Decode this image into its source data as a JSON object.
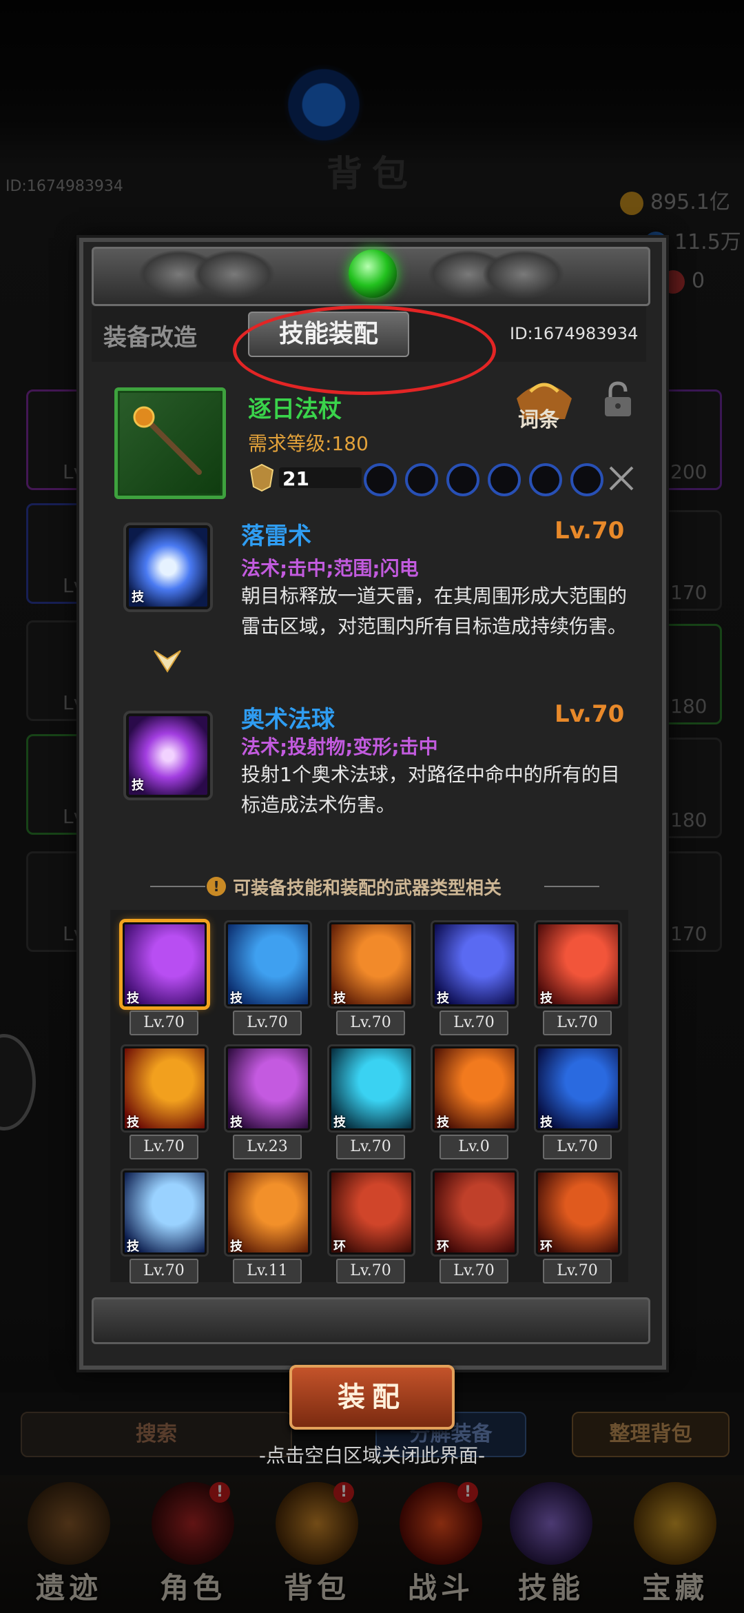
{
  "background": {
    "title": "背包",
    "user_id": "ID:1674983934",
    "resources": [
      {
        "value": "895.1亿",
        "icon": "gold-icon",
        "color": "#c8901e"
      },
      {
        "value": "11.5万",
        "icon": "gem-icon",
        "color": "#2a7be0"
      },
      {
        "value": "0",
        "icon": "ticket-icon",
        "color": "#b03030"
      }
    ],
    "side_levels": [
      "Lv",
      "Lv",
      "Lv",
      "Lv",
      "Lv",
      "Lv"
    ],
    "right_levels": [
      "200",
      "170",
      "180",
      "180",
      "170"
    ]
  },
  "bottom_bar": {
    "search_label": "搜索",
    "decompose_label": "分解装备",
    "sort_label": "整理背包",
    "close_hint": "-点击空白区域关闭此界面-"
  },
  "nav": [
    {
      "label": "遗迹",
      "icon": "relic-icon",
      "badge": ""
    },
    {
      "label": "角色",
      "icon": "character-icon",
      "badge": "!"
    },
    {
      "label": "背包",
      "icon": "backpack-icon",
      "badge": "!"
    },
    {
      "label": "战斗",
      "icon": "battle-icon",
      "badge": "!"
    },
    {
      "label": "技能",
      "icon": "skill-book-icon",
      "badge": ""
    },
    {
      "label": "宝藏",
      "icon": "treasure-icon",
      "badge": ""
    }
  ],
  "panel": {
    "tabs": {
      "modify": "装备改造",
      "skill": "技能装配"
    },
    "active_tab": "skill",
    "user_id": "ID:1674983934",
    "weapon": {
      "name": "逐日法杖",
      "requirement": "需求等级:180",
      "level": "21",
      "entry_label": "词条",
      "sockets": 6,
      "quality_color": "#3ea23e"
    },
    "skills": [
      {
        "name": "落雷术",
        "level": "Lv.70",
        "tags": "法术;击中;范围;闪电",
        "description": "朝目标释放一道天雷，在其周围形成大范围的雷击区域，对范围内所有目标造成持续伤害。",
        "tag_label": "技",
        "icon": "lightning-storm-icon"
      },
      {
        "name": "奥术法球",
        "level": "Lv.70",
        "tags": "法术;投射物;变形;击中",
        "description": "投射1个奥术法球，对路径中命中的所有的目标造成法术伤害。",
        "tag_label": "技",
        "icon": "arcane-orb-icon"
      }
    ],
    "note": "可装备技能和装配的武器类型相关",
    "grid": [
      {
        "level": "Lv.70",
        "tag": "技",
        "icon": "arcane-orb-icon",
        "colors": [
          "#3a0a6a",
          "#b84ef2"
        ],
        "selected": true
      },
      {
        "level": "Lv.70",
        "tag": "技",
        "icon": "water-orb-icon",
        "colors": [
          "#0a2a6a",
          "#3fa0f0"
        ],
        "selected": false
      },
      {
        "level": "Lv.70",
        "tag": "技",
        "icon": "fire-slash-icon",
        "colors": [
          "#5a1a05",
          "#f28a2a"
        ],
        "selected": false
      },
      {
        "level": "Lv.70",
        "tag": "技",
        "icon": "lightning-chain-icon",
        "colors": [
          "#0a0a4a",
          "#5a6af2"
        ],
        "selected": false
      },
      {
        "level": "Lv.70",
        "tag": "技",
        "icon": "meteor-icon",
        "colors": [
          "#4a0a0a",
          "#f2553a"
        ],
        "selected": false
      },
      {
        "level": "Lv.70",
        "tag": "技",
        "icon": "fireball-icon",
        "colors": [
          "#6a0a05",
          "#f2a01e"
        ],
        "selected": false
      },
      {
        "level": "Lv.23",
        "tag": "技",
        "icon": "arcane-rain-icon",
        "colors": [
          "#2a0a3a",
          "#c45ae0"
        ],
        "selected": false
      },
      {
        "level": "Lv.70",
        "tag": "技",
        "icon": "ice-shard-icon",
        "colors": [
          "#052a3a",
          "#3ad2f2"
        ],
        "selected": false
      },
      {
        "level": "Lv.0",
        "tag": "技",
        "icon": "flame-fist-icon",
        "colors": [
          "#4a1005",
          "#f27a1e"
        ],
        "selected": false
      },
      {
        "level": "Lv.70",
        "tag": "技",
        "icon": "thunder-icon",
        "colors": [
          "#050a3a",
          "#2a6ae0"
        ],
        "selected": false
      },
      {
        "level": "Lv.70",
        "tag": "技",
        "icon": "lightning-storm-icon",
        "colors": [
          "#0a1a4a",
          "#9ad2ff"
        ],
        "selected": false
      },
      {
        "level": "Lv.11",
        "tag": "技",
        "icon": "fire-rain-icon",
        "colors": [
          "#5a1a05",
          "#f2902a"
        ],
        "selected": false
      },
      {
        "level": "Lv.70",
        "tag": "环",
        "icon": "fire-aura-icon",
        "colors": [
          "#3a0a05",
          "#d0452a"
        ],
        "selected": false
      },
      {
        "level": "Lv.70",
        "tag": "环",
        "icon": "blood-aura-icon",
        "colors": [
          "#3a0505",
          "#c0402a"
        ],
        "selected": false
      },
      {
        "level": "Lv.70",
        "tag": "环",
        "icon": "magma-aura-icon",
        "colors": [
          "#3a0a05",
          "#e05a1e"
        ],
        "selected": false
      }
    ],
    "equip_button": "装配"
  }
}
